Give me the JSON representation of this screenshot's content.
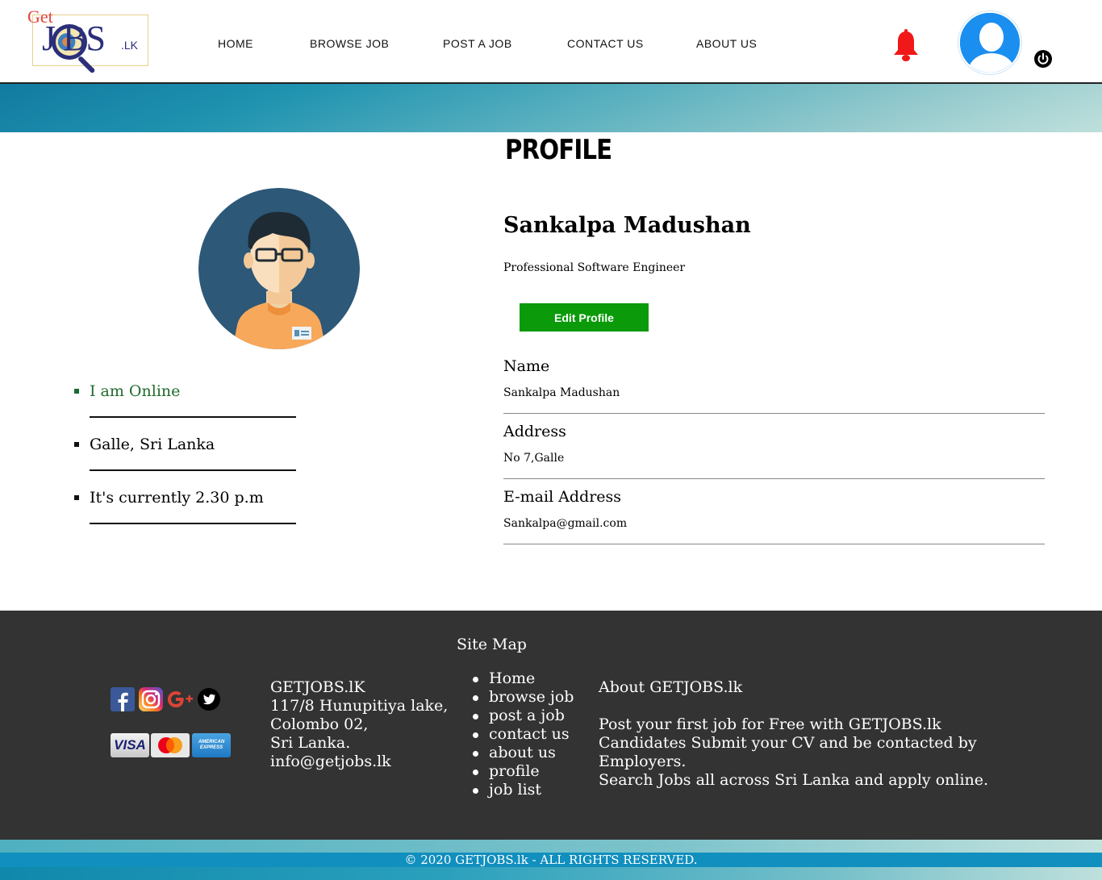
{
  "brand": {
    "logo_get": "Get",
    "logo_jobs": "J  BS",
    "logo_lk": ".LK"
  },
  "nav": {
    "items": [
      "HOME",
      "BROWSE JOB",
      "POST A JOB",
      "CONTACT US",
      "ABOUT US"
    ]
  },
  "header_icons": {
    "notification": "bell-icon",
    "notification_color": "#f01818",
    "user": "user-avatar-icon",
    "user_color": "#1a8ff0",
    "logout": "power-icon"
  },
  "profile": {
    "page_title": "PROFILE",
    "full_name": "Sankalpa Madushan",
    "job_title": "Professional Software Engineer",
    "edit_button": "Edit Profile",
    "edit_button_color": "#0a9a0a",
    "status_items": [
      {
        "text": "I am Online",
        "color": "#1f6b2c"
      },
      {
        "text": "Galle, Sri Lanka"
      },
      {
        "text": "It's currently 2.30 p.m"
      }
    ],
    "fields": [
      {
        "label": "Name",
        "value": "Sankalpa Madushan"
      },
      {
        "label": "Address",
        "value": "No 7,Galle"
      },
      {
        "label": "E-mail Address",
        "value": "Sankalpa@gmail.com"
      }
    ]
  },
  "footer": {
    "sitemap_title": "Site Map",
    "social_icons": [
      "facebook-icon",
      "instagram-icon",
      "google-plus-icon",
      "twitter-icon"
    ],
    "payment_cards": [
      "VISA",
      "MasterCard",
      "AMERICAN EXPRESS"
    ],
    "address_lines": [
      "GETJOBS.lK",
      "117/8 Hunupitiya lake,",
      "Colombo 02,",
      "Sri Lanka.",
      "info@getjobs.lk"
    ],
    "sitemap_links": [
      "Home",
      "browse job",
      "post a job",
      "contact us",
      "about us",
      "profile",
      "job list"
    ],
    "about_title": "About GETJOBS.lk",
    "about_lines": [
      "Post your first job for Free with GETJOBS.lk",
      "Candidates Submit your CV and be contacted by Employers.",
      "Search Jobs all across Sri Lanka and apply online."
    ],
    "copyright": "© 2020 GETJOBS.lk - ALL RIGHTS RESERVED."
  }
}
